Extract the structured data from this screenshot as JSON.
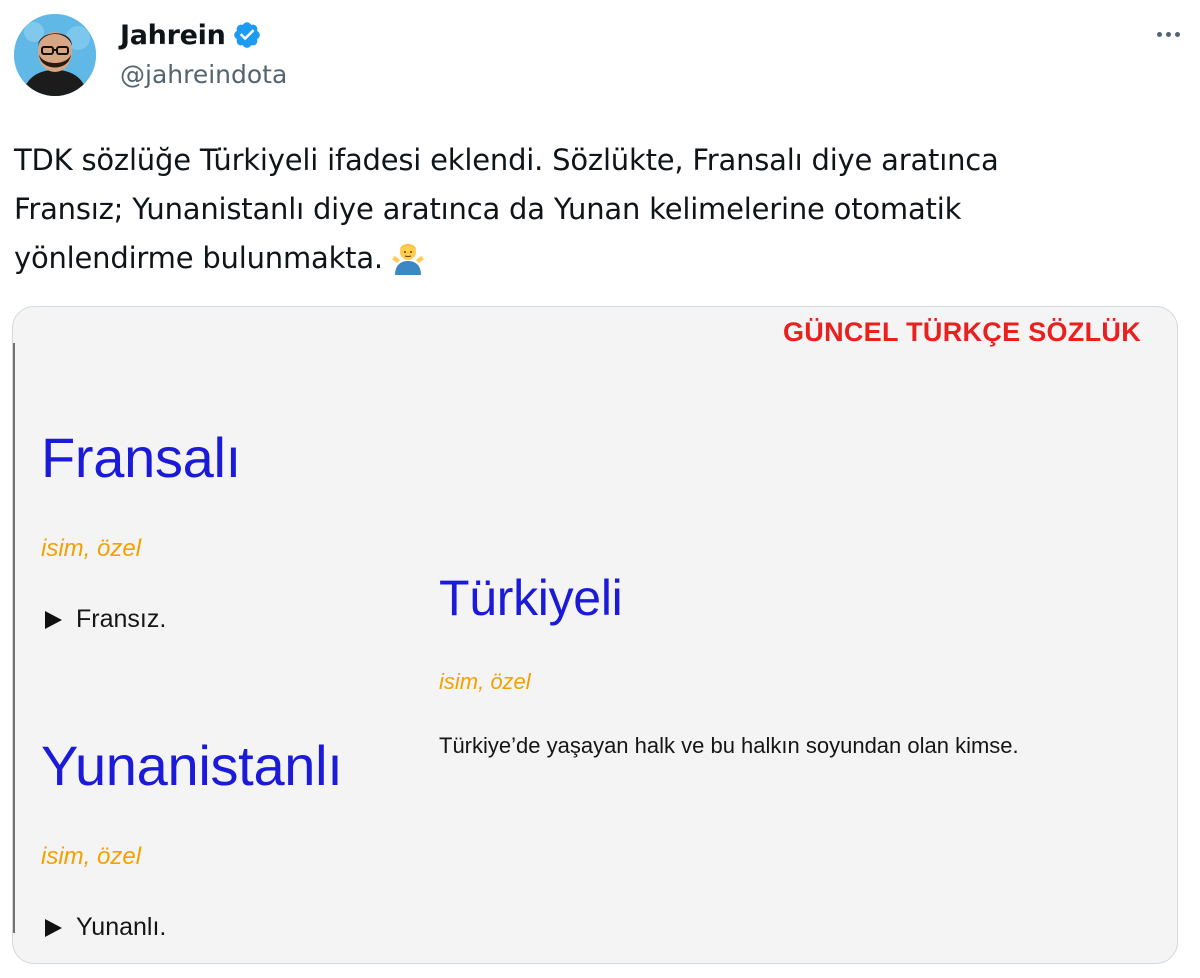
{
  "tweet": {
    "author": {
      "display_name": "Jahrein",
      "handle": "@jahreindota",
      "verified": true,
      "verified_color": "#1d9bf0"
    },
    "more_icon": "more-horizontal-icon",
    "text_lines": [
      "TDK sözlüğe Türkiyeli ifadesi eklendi. Sözlükte, Fransalı diye aratınca",
      "Fransız; Yunanistanlı diye aratınca da Yunan kelimelerine otomatik",
      "yönlendirme bulunmakta."
    ],
    "emoji": "man-shrugging-emoji"
  },
  "media": {
    "dictionary_title": "GÜNCEL TÜRKÇE SÖZLÜK",
    "colors": {
      "title": "#e8201e",
      "word": "#1a1ad8",
      "part_of_speech": "#f5a000"
    },
    "entries": [
      {
        "word": "Fransalı",
        "part_of_speech": "isim, özel",
        "definition": "Fransız."
      },
      {
        "word": "Yunanistanlı",
        "part_of_speech": "isim, özel",
        "definition": "Yunanlı."
      },
      {
        "word": "Türkiyeli",
        "part_of_speech": "isim, özel",
        "definition": "Türkiye’de yaşayan halk ve bu halkın soyundan olan kimse."
      }
    ]
  }
}
